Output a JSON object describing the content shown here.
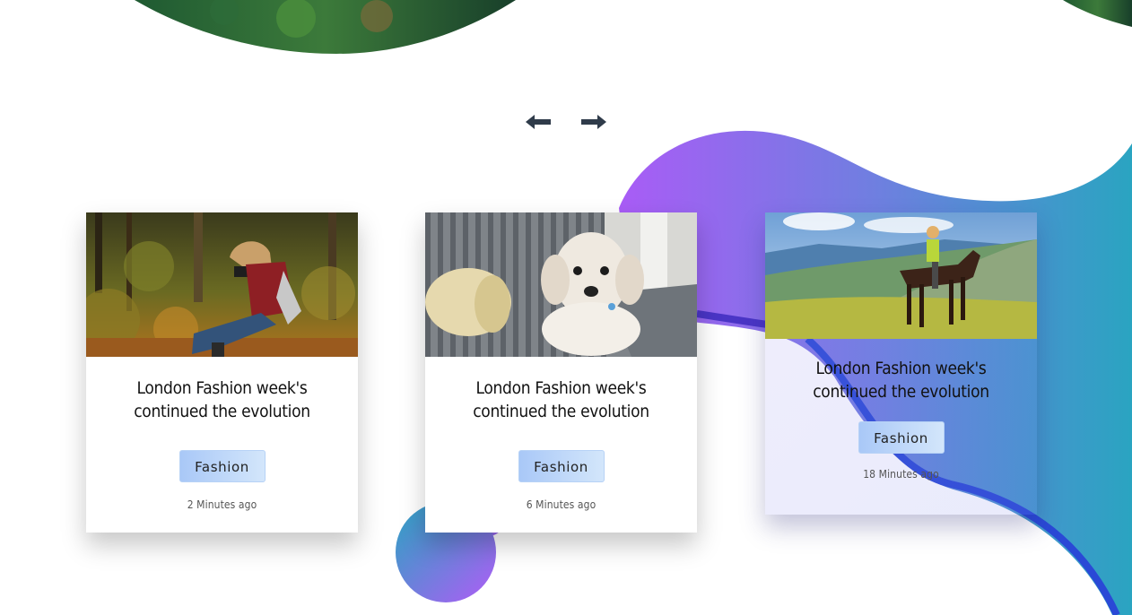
{
  "navigation": {
    "prev_label": "Previous",
    "next_label": "Next"
  },
  "cards": [
    {
      "title": "London Fashion week's continued the evolution",
      "tag": "Fashion",
      "time": "2 Minutes ago",
      "image": "photographer-in-forest"
    },
    {
      "title": "London Fashion week's continued the evolution",
      "tag": "Fashion",
      "time": "6 Minutes ago",
      "image": "white-dog-on-sofa"
    },
    {
      "title": "London Fashion week's continued the evolution",
      "tag": "Fashion",
      "time": "18 Minutes ago",
      "image": "horse-rider-in-mountains"
    }
  ],
  "colors": {
    "arrow": "#2f3b4a",
    "blob_start": "#a95cf6",
    "blob_end": "#2aa4c1",
    "tag_start": "#a9c8f7",
    "tag_end": "#d3e6fb"
  }
}
